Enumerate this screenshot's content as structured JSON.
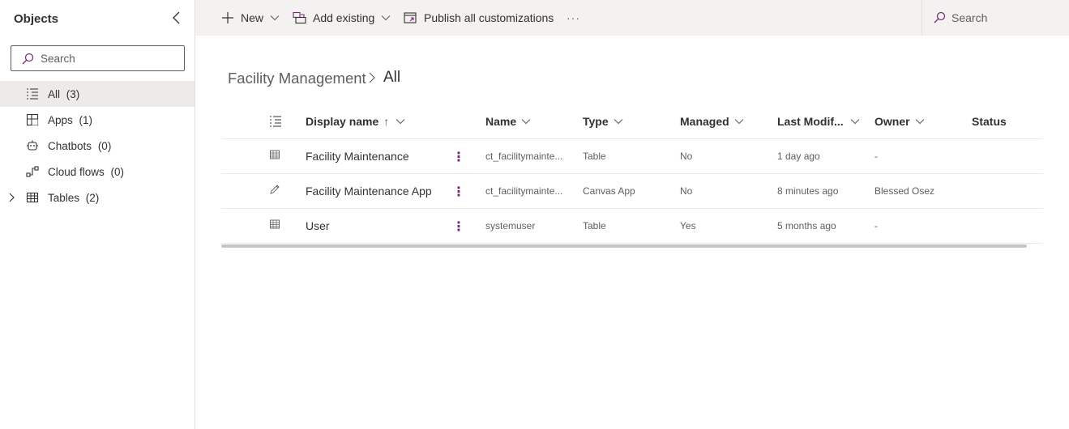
{
  "sidebar": {
    "title": "Objects",
    "search_placeholder": "Search",
    "items": [
      {
        "label": "All",
        "count": "(3)",
        "icon": "list-icon",
        "selected": true
      },
      {
        "label": "Apps",
        "count": "(1)",
        "icon": "apps-icon"
      },
      {
        "label": "Chatbots",
        "count": "(0)",
        "icon": "bot-icon"
      },
      {
        "label": "Cloud flows",
        "count": "(0)",
        "icon": "flow-icon"
      },
      {
        "label": "Tables",
        "count": "(2)",
        "icon": "table-icon",
        "expandable": true
      }
    ]
  },
  "commandbar": {
    "new_label": "New",
    "add_existing_label": "Add existing",
    "publish_label": "Publish all customizations",
    "more_label": "···",
    "search_placeholder": "Search"
  },
  "breadcrumb": {
    "parent": "Facility Management",
    "current": "All"
  },
  "table": {
    "columns": {
      "display_name": "Display name",
      "display_name_sort": "↑",
      "name": "Name",
      "type": "Type",
      "managed": "Managed",
      "last_modified": "Last Modif...",
      "owner": "Owner",
      "status": "Status"
    },
    "rows": [
      {
        "icon": "table-icon",
        "display_name": "Facility Maintenance",
        "more": "⋮",
        "name": "ct_facilitymainte...",
        "type": "Table",
        "managed": "No",
        "last_modified": "1 day ago",
        "owner": "-",
        "status": ""
      },
      {
        "icon": "pencil-icon",
        "display_name": "Facility Maintenance App",
        "more": "⋮",
        "name": "ct_facilitymainte...",
        "type": "Canvas App",
        "managed": "No",
        "last_modified": "8 minutes ago",
        "owner": "Blessed Osez",
        "status": ""
      },
      {
        "icon": "table-icon",
        "display_name": "User",
        "more": "⋮",
        "name": "systemuser",
        "type": "Table",
        "managed": "Yes",
        "last_modified": "5 months ago",
        "owner": "-",
        "status": ""
      }
    ]
  },
  "colors": {
    "accent": "#742774",
    "selected_bg": "#edebe9",
    "commandbar_bg": "#f3f2f1"
  }
}
